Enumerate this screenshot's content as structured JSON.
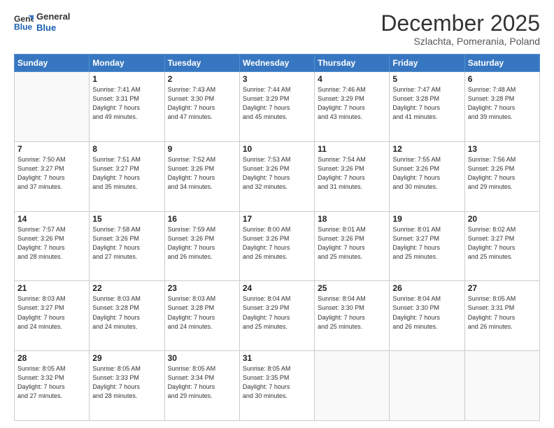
{
  "header": {
    "logo_general": "General",
    "logo_blue": "Blue",
    "month": "December 2025",
    "location": "Szlachta, Pomerania, Poland"
  },
  "days_of_week": [
    "Sunday",
    "Monday",
    "Tuesday",
    "Wednesday",
    "Thursday",
    "Friday",
    "Saturday"
  ],
  "weeks": [
    [
      {
        "day": "",
        "sunrise": "",
        "sunset": "",
        "daylight": ""
      },
      {
        "day": "1",
        "sunrise": "Sunrise: 7:41 AM",
        "sunset": "Sunset: 3:31 PM",
        "daylight": "Daylight: 7 hours and 49 minutes."
      },
      {
        "day": "2",
        "sunrise": "Sunrise: 7:43 AM",
        "sunset": "Sunset: 3:30 PM",
        "daylight": "Daylight: 7 hours and 47 minutes."
      },
      {
        "day": "3",
        "sunrise": "Sunrise: 7:44 AM",
        "sunset": "Sunset: 3:29 PM",
        "daylight": "Daylight: 7 hours and 45 minutes."
      },
      {
        "day": "4",
        "sunrise": "Sunrise: 7:46 AM",
        "sunset": "Sunset: 3:29 PM",
        "daylight": "Daylight: 7 hours and 43 minutes."
      },
      {
        "day": "5",
        "sunrise": "Sunrise: 7:47 AM",
        "sunset": "Sunset: 3:28 PM",
        "daylight": "Daylight: 7 hours and 41 minutes."
      },
      {
        "day": "6",
        "sunrise": "Sunrise: 7:48 AM",
        "sunset": "Sunset: 3:28 PM",
        "daylight": "Daylight: 7 hours and 39 minutes."
      }
    ],
    [
      {
        "day": "7",
        "sunrise": "Sunrise: 7:50 AM",
        "sunset": "Sunset: 3:27 PM",
        "daylight": "Daylight: 7 hours and 37 minutes."
      },
      {
        "day": "8",
        "sunrise": "Sunrise: 7:51 AM",
        "sunset": "Sunset: 3:27 PM",
        "daylight": "Daylight: 7 hours and 35 minutes."
      },
      {
        "day": "9",
        "sunrise": "Sunrise: 7:52 AM",
        "sunset": "Sunset: 3:26 PM",
        "daylight": "Daylight: 7 hours and 34 minutes."
      },
      {
        "day": "10",
        "sunrise": "Sunrise: 7:53 AM",
        "sunset": "Sunset: 3:26 PM",
        "daylight": "Daylight: 7 hours and 32 minutes."
      },
      {
        "day": "11",
        "sunrise": "Sunrise: 7:54 AM",
        "sunset": "Sunset: 3:26 PM",
        "daylight": "Daylight: 7 hours and 31 minutes."
      },
      {
        "day": "12",
        "sunrise": "Sunrise: 7:55 AM",
        "sunset": "Sunset: 3:26 PM",
        "daylight": "Daylight: 7 hours and 30 minutes."
      },
      {
        "day": "13",
        "sunrise": "Sunrise: 7:56 AM",
        "sunset": "Sunset: 3:26 PM",
        "daylight": "Daylight: 7 hours and 29 minutes."
      }
    ],
    [
      {
        "day": "14",
        "sunrise": "Sunrise: 7:57 AM",
        "sunset": "Sunset: 3:26 PM",
        "daylight": "Daylight: 7 hours and 28 minutes."
      },
      {
        "day": "15",
        "sunrise": "Sunrise: 7:58 AM",
        "sunset": "Sunset: 3:26 PM",
        "daylight": "Daylight: 7 hours and 27 minutes."
      },
      {
        "day": "16",
        "sunrise": "Sunrise: 7:59 AM",
        "sunset": "Sunset: 3:26 PM",
        "daylight": "Daylight: 7 hours and 26 minutes."
      },
      {
        "day": "17",
        "sunrise": "Sunrise: 8:00 AM",
        "sunset": "Sunset: 3:26 PM",
        "daylight": "Daylight: 7 hours and 26 minutes."
      },
      {
        "day": "18",
        "sunrise": "Sunrise: 8:01 AM",
        "sunset": "Sunset: 3:26 PM",
        "daylight": "Daylight: 7 hours and 25 minutes."
      },
      {
        "day": "19",
        "sunrise": "Sunrise: 8:01 AM",
        "sunset": "Sunset: 3:27 PM",
        "daylight": "Daylight: 7 hours and 25 minutes."
      },
      {
        "day": "20",
        "sunrise": "Sunrise: 8:02 AM",
        "sunset": "Sunset: 3:27 PM",
        "daylight": "Daylight: 7 hours and 25 minutes."
      }
    ],
    [
      {
        "day": "21",
        "sunrise": "Sunrise: 8:03 AM",
        "sunset": "Sunset: 3:27 PM",
        "daylight": "Daylight: 7 hours and 24 minutes."
      },
      {
        "day": "22",
        "sunrise": "Sunrise: 8:03 AM",
        "sunset": "Sunset: 3:28 PM",
        "daylight": "Daylight: 7 hours and 24 minutes."
      },
      {
        "day": "23",
        "sunrise": "Sunrise: 8:03 AM",
        "sunset": "Sunset: 3:28 PM",
        "daylight": "Daylight: 7 hours and 24 minutes."
      },
      {
        "day": "24",
        "sunrise": "Sunrise: 8:04 AM",
        "sunset": "Sunset: 3:29 PM",
        "daylight": "Daylight: 7 hours and 25 minutes."
      },
      {
        "day": "25",
        "sunrise": "Sunrise: 8:04 AM",
        "sunset": "Sunset: 3:30 PM",
        "daylight": "Daylight: 7 hours and 25 minutes."
      },
      {
        "day": "26",
        "sunrise": "Sunrise: 8:04 AM",
        "sunset": "Sunset: 3:30 PM",
        "daylight": "Daylight: 7 hours and 26 minutes."
      },
      {
        "day": "27",
        "sunrise": "Sunrise: 8:05 AM",
        "sunset": "Sunset: 3:31 PM",
        "daylight": "Daylight: 7 hours and 26 minutes."
      }
    ],
    [
      {
        "day": "28",
        "sunrise": "Sunrise: 8:05 AM",
        "sunset": "Sunset: 3:32 PM",
        "daylight": "Daylight: 7 hours and 27 minutes."
      },
      {
        "day": "29",
        "sunrise": "Sunrise: 8:05 AM",
        "sunset": "Sunset: 3:33 PM",
        "daylight": "Daylight: 7 hours and 28 minutes."
      },
      {
        "day": "30",
        "sunrise": "Sunrise: 8:05 AM",
        "sunset": "Sunset: 3:34 PM",
        "daylight": "Daylight: 7 hours and 29 minutes."
      },
      {
        "day": "31",
        "sunrise": "Sunrise: 8:05 AM",
        "sunset": "Sunset: 3:35 PM",
        "daylight": "Daylight: 7 hours and 30 minutes."
      },
      {
        "day": "",
        "sunrise": "",
        "sunset": "",
        "daylight": ""
      },
      {
        "day": "",
        "sunrise": "",
        "sunset": "",
        "daylight": ""
      },
      {
        "day": "",
        "sunrise": "",
        "sunset": "",
        "daylight": ""
      }
    ]
  ]
}
